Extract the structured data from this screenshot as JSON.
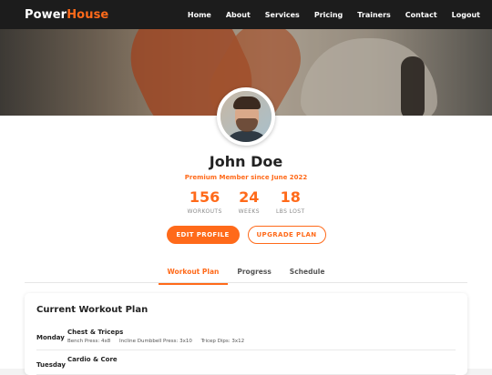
{
  "brand": {
    "part1": "Power",
    "part2": "House",
    "accent": "#ff6a1a"
  },
  "nav": {
    "items": [
      "Home",
      "About",
      "Services",
      "Pricing",
      "Trainers",
      "Contact",
      "Logout"
    ]
  },
  "profile": {
    "name": "John Doe",
    "membership": "Premium Member since June 2022",
    "stats": [
      {
        "value": "156",
        "label": "WORKOUTS"
      },
      {
        "value": "24",
        "label": "WEEKS"
      },
      {
        "value": "18",
        "label": "LBS LOST"
      }
    ],
    "buttons": {
      "edit": "EDIT PROFILE",
      "upgrade": "UPGRADE PLAN"
    }
  },
  "tabs": [
    {
      "label": "Workout Plan",
      "active": true
    },
    {
      "label": "Progress",
      "active": false
    },
    {
      "label": "Schedule",
      "active": false
    }
  ],
  "plan": {
    "heading": "Current Workout Plan",
    "days": [
      {
        "day": "Monday",
        "title": "Chest & Triceps",
        "exercises": [
          "Bench Press: 4x8",
          "Incline Dumbbell Press: 3x10",
          "Tricep Dips: 3x12"
        ]
      },
      {
        "day": "Tuesday",
        "title": "Cardio & Core",
        "exercises": []
      }
    ]
  }
}
